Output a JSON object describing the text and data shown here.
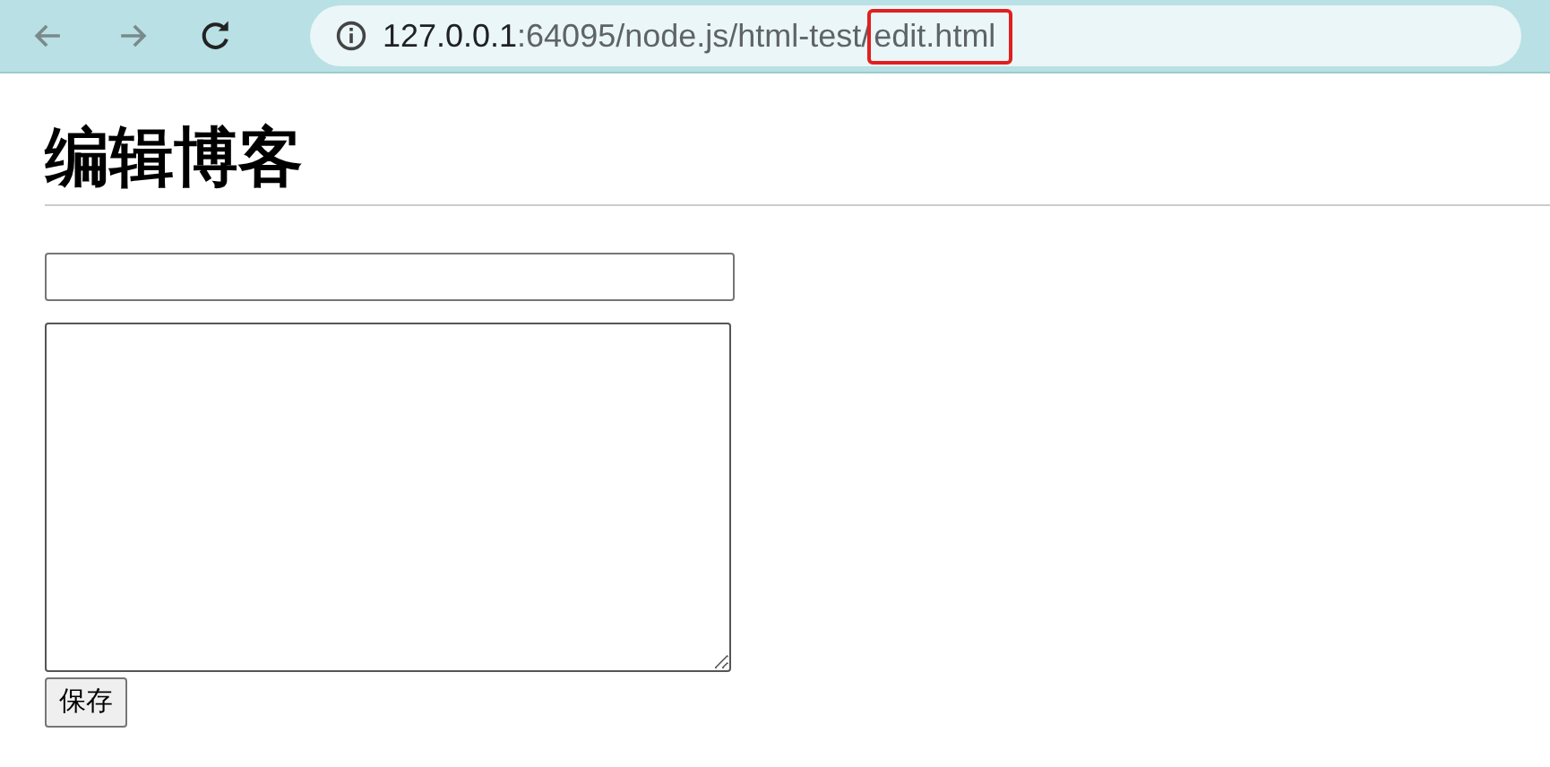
{
  "browser": {
    "address": {
      "host": "127.0.0.1",
      "path": ":64095/node.js/html-test/",
      "file": "edit.html",
      "file_highlighted": true
    }
  },
  "page": {
    "heading": "编辑博客",
    "fields": [
      {
        "kind": "text"
      },
      {
        "kind": "textarea"
      }
    ],
    "save_button": "保存"
  }
}
